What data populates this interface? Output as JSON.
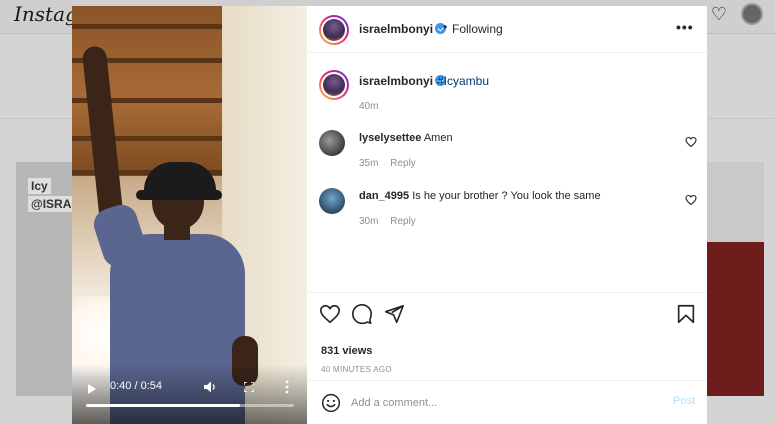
{
  "background": {
    "logo_text": "Instagr",
    "card_left_lines": [
      "Icy",
      "@ISRAE"
    ]
  },
  "video": {
    "time_display": "0:40 / 0:54",
    "progress_fraction": 0.74
  },
  "post": {
    "header": {
      "username": "israelmbonyi",
      "separator": "•",
      "follow_status": "Following",
      "more_label": "•••"
    },
    "caption": {
      "username": "israelmbonyi",
      "hashtag": "#Icyambu",
      "time_ago": "40m"
    },
    "comments": [
      {
        "username": "lyselysettee",
        "text": "Amen",
        "time_ago": "35m",
        "reply_label": "Reply"
      },
      {
        "username": "dan_4995",
        "text": "Is he your brother ? You look the same",
        "time_ago": "30m",
        "reply_label": "Reply"
      }
    ],
    "stats": {
      "views": "831 views",
      "posted": "40 MINUTES AGO"
    },
    "comment_box": {
      "placeholder": "Add a comment...",
      "post_label": "Post"
    }
  },
  "colors": {
    "verified": "#3897f0",
    "hashtag": "#00376b",
    "post_button_disabled": "#b2dffc"
  },
  "icons": {
    "header_avatar": "avatar",
    "verified": "verified-badge-icon",
    "like": "heart-icon",
    "comment": "comment-bubble-icon",
    "share": "paper-plane-icon",
    "save": "bookmark-icon",
    "emoji": "smiley-icon"
  }
}
